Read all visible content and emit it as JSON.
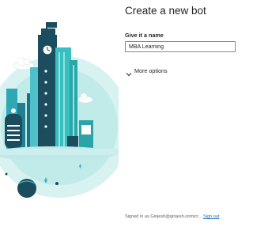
{
  "dialog": {
    "title": "Create a new bot",
    "name_label": "Give it a name",
    "name_value": "MBA Learning",
    "more_options_label": "More options"
  },
  "footer": {
    "signed_in_text": "Signed in as Ginjesh@ginjesh.onmicr...",
    "sign_out_label": "Sign out"
  },
  "illustration": {
    "icon": "city-bot-illustration",
    "colors": {
      "teal": "#2ec4b6",
      "dark": "#1b4d5e",
      "light_teal": "#d6f1f0",
      "accent": "#48b8c4"
    }
  }
}
